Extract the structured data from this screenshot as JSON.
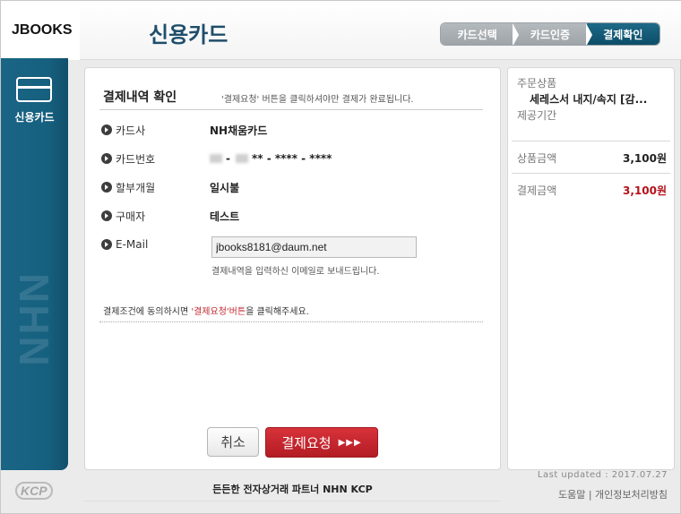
{
  "header": {
    "brand": "JBOOKS",
    "title": "신용카드",
    "steps": [
      "카드선택",
      "카드인증",
      "결제확인"
    ],
    "active_step": 2
  },
  "sidebar": {
    "label": "신용카드",
    "icon": "credit-card-icon",
    "watermark": "NHN KCP"
  },
  "section": {
    "title": "결제내역 확인",
    "note": "'결제요청' 버튼을 클릭하셔야만 결제가 완료됩니다."
  },
  "fields": [
    {
      "label": "카드사",
      "value": "NH채움카드"
    },
    {
      "label": "카드번호",
      "value": "** - **** - ****"
    },
    {
      "label": "할부개월",
      "value": "일시불"
    },
    {
      "label": "구매자",
      "value": "테스트"
    },
    {
      "label": "E-Mail",
      "value": ""
    }
  ],
  "email": {
    "value": "jbooks8181@daum.net",
    "help": "결제내역을 입력하신 이메일로 보내드립니다."
  },
  "agree": {
    "prefix": "결제조건에 동의하시면 ",
    "highlight": "'결제요청'버튼",
    "suffix": "을 클릭해주세요."
  },
  "buttons": {
    "cancel": "취소",
    "pay": "결제요청",
    "pay_arrows": "▶▶▶"
  },
  "summary": {
    "product_label": "주문상품",
    "product_name": "세레스서 내지/속지 [감...",
    "period_label": "제공기간",
    "price_label": "상품금액",
    "price_value": "3,100원",
    "pay_label": "결제금액",
    "pay_value": "3,100원"
  },
  "footer": {
    "updated": "Last updated : 2017.07.27",
    "help_link": "도움말",
    "privacy_link": "개인정보처리방침",
    "separator": " | ",
    "tagline": "든든한 전자상거래 파트너 NHN KCP",
    "logo": "KCP"
  }
}
